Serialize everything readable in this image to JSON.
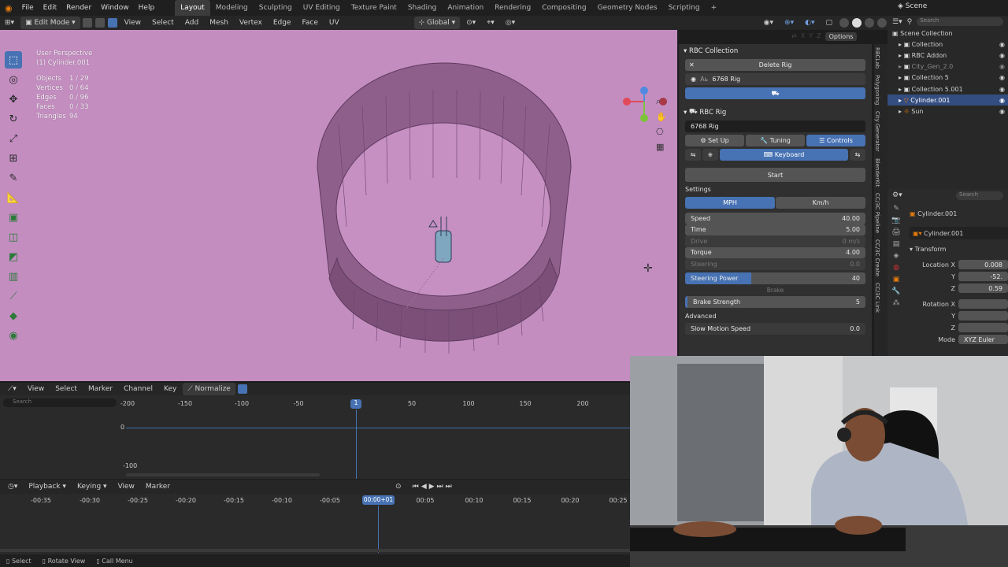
{
  "menubar": {
    "items": [
      "File",
      "Edit",
      "Render",
      "Window",
      "Help"
    ],
    "workspaces": [
      "Layout",
      "Modeling",
      "Sculpting",
      "UV Editing",
      "Texture Paint",
      "Shading",
      "Animation",
      "Rendering",
      "Compositing",
      "Geometry Nodes",
      "Scripting"
    ],
    "active_workspace": "Layout",
    "scene": "Scene"
  },
  "viewport_header": {
    "mode": "Edit Mode",
    "menus": [
      "View",
      "Select",
      "Add",
      "Mesh",
      "Vertex",
      "Edge",
      "Face",
      "UV"
    ],
    "transform_orientation": "Global",
    "options": "Options",
    "axes": [
      "X",
      "Y",
      "Z"
    ]
  },
  "viewport": {
    "perspective": "User Perspective",
    "object": "(1) Cylinder.001",
    "stats": [
      {
        "label": "Objects",
        "value": "1 / 29"
      },
      {
        "label": "Vertices",
        "value": "0 / 64"
      },
      {
        "label": "Edges",
        "value": "0 / 96"
      },
      {
        "label": "Faces",
        "value": "0 / 33"
      },
      {
        "label": "Triangles",
        "value": "94"
      }
    ]
  },
  "npanel": {
    "collection_title": "RBC Collection",
    "delete_rig": "Delete Rig",
    "rig_name": "6768 Rig",
    "rig_title": "RBC Rig",
    "rig_field": "6768 Rig",
    "tabs": [
      "Set Up",
      "Tuning",
      "Controls"
    ],
    "active_tab": "Controls",
    "keyboard": "Keyboard",
    "start": "Start",
    "settings_label": "Settings",
    "units": [
      "MPH",
      "Km/h"
    ],
    "settings": [
      {
        "label": "Speed",
        "value": "40.00",
        "dim": false
      },
      {
        "label": "Time",
        "value": "5.00",
        "dim": false
      },
      {
        "label": "Drive",
        "value": "0 m/s",
        "dim": true
      },
      {
        "label": "Torque",
        "value": "4.00",
        "dim": false
      },
      {
        "label": "Steering",
        "value": "0.0",
        "dim": true
      }
    ],
    "steering_power": {
      "label": "Steering Power",
      "value": "40",
      "fill": 0.4
    },
    "brake_label": "Brake",
    "brake_strength": {
      "label": "Brake Strength",
      "value": "5"
    },
    "advanced_label": "Advanced",
    "slow_motion": {
      "label": "Slow Motion Speed",
      "value": "0.0"
    },
    "side_tabs": [
      "RBCLab",
      "Polygoning",
      "City Generator",
      "BlenderKit",
      "CC/3C Pipeline",
      "CC/3C Create",
      "CC/3C Link"
    ]
  },
  "outliner": {
    "title": "Scene Collection",
    "items": [
      {
        "name": "Collection",
        "dim": false,
        "sel": false
      },
      {
        "name": "RBC Addon",
        "dim": false,
        "sel": false
      },
      {
        "name": "City_Gen_2.0",
        "dim": true,
        "sel": false
      },
      {
        "name": "Collection 5",
        "dim": false,
        "sel": false
      },
      {
        "name": "Collection 5.001",
        "dim": false,
        "sel": false
      },
      {
        "name": "Cylinder.001",
        "dim": false,
        "sel": true
      },
      {
        "name": "Sun",
        "dim": false,
        "sel": false
      }
    ],
    "search_placeholder": "Search"
  },
  "properties": {
    "object_name": "Cylinder.001",
    "object_field": "Cylinder.001",
    "section": "Transform",
    "location_label": "Location X",
    "location": [
      "0.008",
      "-52.",
      "0.59"
    ],
    "rotation_label": "Rotation X",
    "mode_label": "Mode",
    "mode_value": "XYZ Euler",
    "search_placeholder": "Search"
  },
  "graph_editor": {
    "menus": [
      "View",
      "Select",
      "Marker",
      "Channel",
      "Key"
    ],
    "normalize": "Normalize",
    "search_placeholder": "Search",
    "ruler": [
      "-200",
      "-150",
      "-100",
      "-50",
      "50",
      "100",
      "150",
      "200"
    ],
    "current_frame": "1",
    "y_labels": [
      "0",
      "-100"
    ]
  },
  "timeline": {
    "menus": [
      "Playback",
      "Keying",
      "View",
      "Marker"
    ],
    "ruler": [
      "-00:35",
      "-00:30",
      "-00:25",
      "-00:20",
      "-00:15",
      "-00:10",
      "-00:05",
      "00:05",
      "00:10",
      "00:15",
      "00:20",
      "00:25"
    ],
    "current_time": "00:00+01"
  },
  "statusbar": [
    "Select",
    "Rotate View",
    "Call Menu"
  ],
  "colors": {
    "accent": "#4772b3",
    "viewport_bg": "#c38dc0"
  }
}
